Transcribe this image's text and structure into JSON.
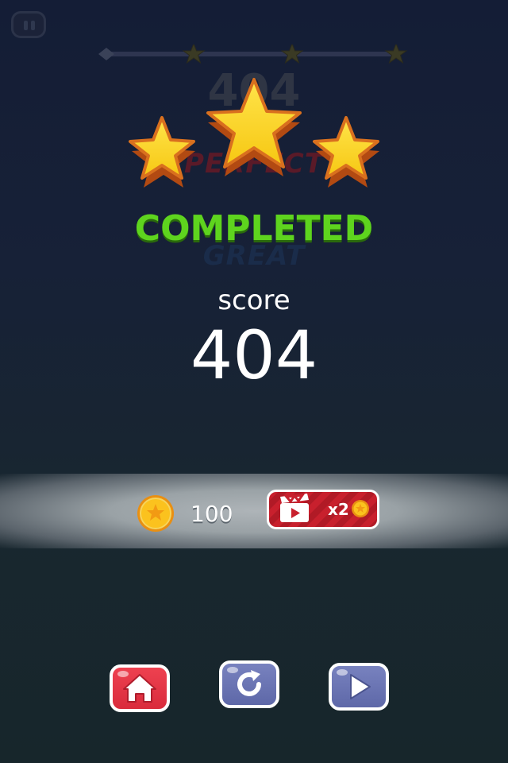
{
  "hud": {
    "pause_icon": "pause-icon"
  },
  "progress": {
    "star_count": 3,
    "filled_stars": 0
  },
  "ghost": {
    "score": "404",
    "rank_perfect": "PERFECT",
    "rank_great": "GREAT"
  },
  "result": {
    "stars_earned": 3,
    "title": "COMPLETED",
    "score_label": "score",
    "score_value": "404"
  },
  "reward": {
    "coin_icon": "coin-icon",
    "coins": "100",
    "video_icon": "video-clapper-icon",
    "multiplier": "x2"
  },
  "actions": [
    {
      "name": "home",
      "icon": "home-icon",
      "color": "#e23545"
    },
    {
      "name": "retry",
      "icon": "retry-icon",
      "color": "#6a74b4"
    },
    {
      "name": "next",
      "icon": "play-icon",
      "color": "#6a74b4"
    }
  ],
  "colors": {
    "completed": "#5ed41e",
    "star_fill": "#f9d21a",
    "star_edge": "#d9701e",
    "video_button": "#c8202d"
  }
}
